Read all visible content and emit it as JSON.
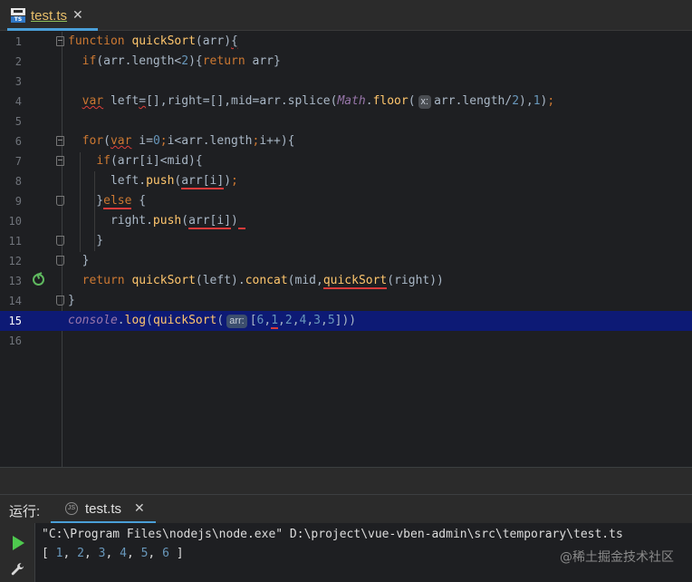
{
  "tab": {
    "title": "test.ts",
    "icon": "typescript-file-icon",
    "close": "✕"
  },
  "code": {
    "line_numbers": [
      "1",
      "2",
      "3",
      "4",
      "5",
      "6",
      "7",
      "8",
      "9",
      "10",
      "11",
      "12",
      "13",
      "14",
      "15",
      "16"
    ],
    "current_line": "15",
    "inlay_hints": {
      "math_floor": "x:",
      "quicksort_arg": "arr:"
    }
  },
  "run_panel": {
    "label": "运行:",
    "tab_title": "test.ts",
    "tab_close": "✕",
    "command": "\"C:\\Program Files\\nodejs\\node.exe\" D:\\project\\vue-vben-admin\\src\\temporary\\test.ts",
    "output": [
      "1",
      "2",
      "3",
      "4",
      "5",
      "6"
    ]
  },
  "watermark": "@稀土掘金技术社区",
  "colors": {
    "keyword": "#cc7832",
    "function": "#ffc66d",
    "number": "#6897bb",
    "accent": "#4a9fd8",
    "current_line": "#0d1a75"
  }
}
